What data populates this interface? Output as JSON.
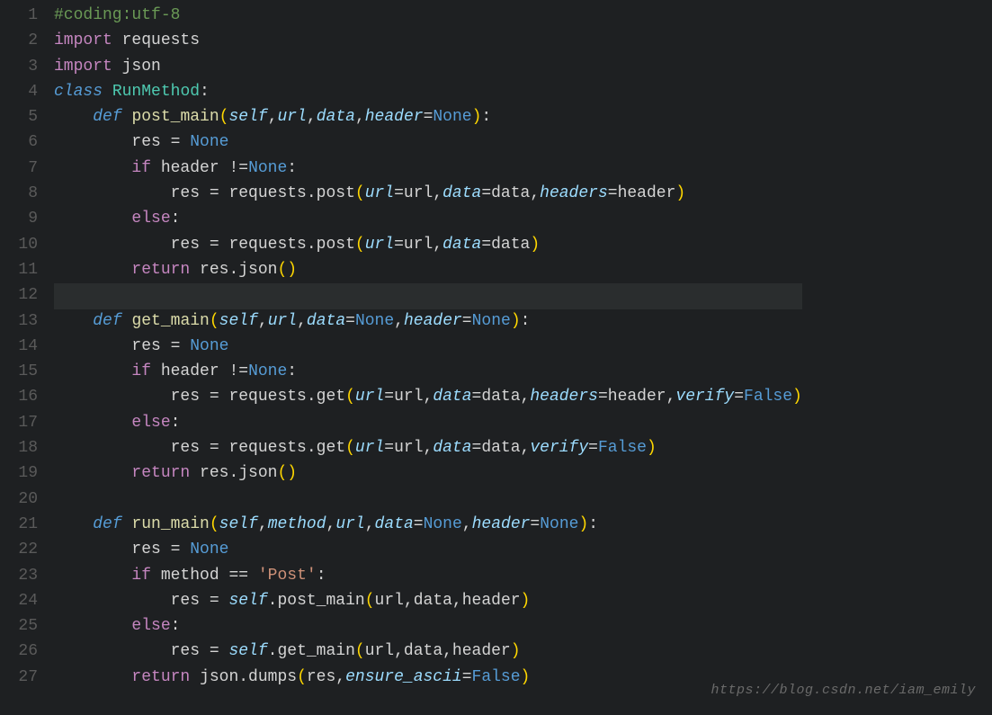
{
  "watermark": "https://blog.csdn.net/iam_emily",
  "gutter": [
    "1",
    "2",
    "3",
    "4",
    "5",
    "6",
    "7",
    "8",
    "9",
    "10",
    "11",
    "12",
    "13",
    "14",
    "15",
    "16",
    "17",
    "18",
    "19",
    "20",
    "21",
    "22",
    "23",
    "24",
    "25",
    "26",
    "27"
  ],
  "current_line_index": 11,
  "code": [
    [
      {
        "c": "cm",
        "t": "#coding:utf-8"
      }
    ],
    [
      {
        "c": "kw",
        "t": "import"
      },
      {
        "c": "va",
        "t": " requests"
      }
    ],
    [
      {
        "c": "kw",
        "t": "import"
      },
      {
        "c": "va",
        "t": " json"
      }
    ],
    [
      {
        "c": "cls",
        "t": "class"
      },
      {
        "c": "va",
        "t": " "
      },
      {
        "c": "nm",
        "t": "RunMethod"
      },
      {
        "c": "va",
        "t": ":"
      }
    ],
    [
      {
        "c": "va",
        "t": "    "
      },
      {
        "c": "cls",
        "t": "def"
      },
      {
        "c": "va",
        "t": " "
      },
      {
        "c": "fn",
        "t": "post_main"
      },
      {
        "c": "pn",
        "t": "("
      },
      {
        "c": "par",
        "t": "self"
      },
      {
        "c": "va",
        "t": ","
      },
      {
        "c": "par",
        "t": "url"
      },
      {
        "c": "va",
        "t": ","
      },
      {
        "c": "par",
        "t": "data"
      },
      {
        "c": "va",
        "t": ","
      },
      {
        "c": "par",
        "t": "header"
      },
      {
        "c": "va",
        "t": "="
      },
      {
        "c": "cn",
        "t": "None"
      },
      {
        "c": "pn",
        "t": ")"
      },
      {
        "c": "va",
        "t": ":"
      }
    ],
    [
      {
        "c": "va",
        "t": "        res "
      },
      {
        "c": "op",
        "t": "="
      },
      {
        "c": "va",
        "t": " "
      },
      {
        "c": "cn",
        "t": "None"
      }
    ],
    [
      {
        "c": "va",
        "t": "        "
      },
      {
        "c": "kw",
        "t": "if"
      },
      {
        "c": "va",
        "t": " header "
      },
      {
        "c": "op",
        "t": "!="
      },
      {
        "c": "cn",
        "t": "None"
      },
      {
        "c": "va",
        "t": ":"
      }
    ],
    [
      {
        "c": "va",
        "t": "            res "
      },
      {
        "c": "op",
        "t": "="
      },
      {
        "c": "va",
        "t": " requests.post"
      },
      {
        "c": "pn",
        "t": "("
      },
      {
        "c": "par",
        "t": "url"
      },
      {
        "c": "va",
        "t": "=url,"
      },
      {
        "c": "par",
        "t": "data"
      },
      {
        "c": "va",
        "t": "=data,"
      },
      {
        "c": "par",
        "t": "headers"
      },
      {
        "c": "va",
        "t": "=header"
      },
      {
        "c": "pn",
        "t": ")"
      }
    ],
    [
      {
        "c": "va",
        "t": "        "
      },
      {
        "c": "kw",
        "t": "else"
      },
      {
        "c": "va",
        "t": ":"
      }
    ],
    [
      {
        "c": "va",
        "t": "            res "
      },
      {
        "c": "op",
        "t": "="
      },
      {
        "c": "va",
        "t": " requests.post"
      },
      {
        "c": "pn",
        "t": "("
      },
      {
        "c": "par",
        "t": "url"
      },
      {
        "c": "va",
        "t": "=url,"
      },
      {
        "c": "par",
        "t": "data"
      },
      {
        "c": "va",
        "t": "=data"
      },
      {
        "c": "pn",
        "t": ")"
      }
    ],
    [
      {
        "c": "va",
        "t": "        "
      },
      {
        "c": "kw",
        "t": "return"
      },
      {
        "c": "va",
        "t": " res.json"
      },
      {
        "c": "pn",
        "t": "()"
      }
    ],
    [
      {
        "c": "va",
        "t": ""
      }
    ],
    [
      {
        "c": "va",
        "t": "    "
      },
      {
        "c": "cls",
        "t": "def"
      },
      {
        "c": "va",
        "t": " "
      },
      {
        "c": "fn",
        "t": "get_main"
      },
      {
        "c": "pn",
        "t": "("
      },
      {
        "c": "par",
        "t": "self"
      },
      {
        "c": "va",
        "t": ","
      },
      {
        "c": "par",
        "t": "url"
      },
      {
        "c": "va",
        "t": ","
      },
      {
        "c": "par",
        "t": "data"
      },
      {
        "c": "va",
        "t": "="
      },
      {
        "c": "cn",
        "t": "None"
      },
      {
        "c": "va",
        "t": ","
      },
      {
        "c": "par",
        "t": "header"
      },
      {
        "c": "va",
        "t": "="
      },
      {
        "c": "cn",
        "t": "None"
      },
      {
        "c": "pn",
        "t": ")"
      },
      {
        "c": "va",
        "t": ":"
      }
    ],
    [
      {
        "c": "va",
        "t": "        res "
      },
      {
        "c": "op",
        "t": "="
      },
      {
        "c": "va",
        "t": " "
      },
      {
        "c": "cn",
        "t": "None"
      }
    ],
    [
      {
        "c": "va",
        "t": "        "
      },
      {
        "c": "kw",
        "t": "if"
      },
      {
        "c": "va",
        "t": " header "
      },
      {
        "c": "op",
        "t": "!="
      },
      {
        "c": "cn",
        "t": "None"
      },
      {
        "c": "va",
        "t": ":"
      }
    ],
    [
      {
        "c": "va",
        "t": "            res "
      },
      {
        "c": "op",
        "t": "="
      },
      {
        "c": "va",
        "t": " requests.get"
      },
      {
        "c": "pn",
        "t": "("
      },
      {
        "c": "par",
        "t": "url"
      },
      {
        "c": "va",
        "t": "=url,"
      },
      {
        "c": "par",
        "t": "data"
      },
      {
        "c": "va",
        "t": "=data,"
      },
      {
        "c": "par",
        "t": "headers"
      },
      {
        "c": "va",
        "t": "=header,"
      },
      {
        "c": "par",
        "t": "verify"
      },
      {
        "c": "va",
        "t": "="
      },
      {
        "c": "cn",
        "t": "False"
      },
      {
        "c": "pn",
        "t": ")"
      }
    ],
    [
      {
        "c": "va",
        "t": "        "
      },
      {
        "c": "kw",
        "t": "else"
      },
      {
        "c": "va",
        "t": ":"
      }
    ],
    [
      {
        "c": "va",
        "t": "            res "
      },
      {
        "c": "op",
        "t": "="
      },
      {
        "c": "va",
        "t": " requests.get"
      },
      {
        "c": "pn",
        "t": "("
      },
      {
        "c": "par",
        "t": "url"
      },
      {
        "c": "va",
        "t": "=url,"
      },
      {
        "c": "par",
        "t": "data"
      },
      {
        "c": "va",
        "t": "=data,"
      },
      {
        "c": "par",
        "t": "verify"
      },
      {
        "c": "va",
        "t": "="
      },
      {
        "c": "cn",
        "t": "False"
      },
      {
        "c": "pn",
        "t": ")"
      }
    ],
    [
      {
        "c": "va",
        "t": "        "
      },
      {
        "c": "kw",
        "t": "return"
      },
      {
        "c": "va",
        "t": " res.json"
      },
      {
        "c": "pn",
        "t": "()"
      }
    ],
    [
      {
        "c": "va",
        "t": ""
      }
    ],
    [
      {
        "c": "va",
        "t": "    "
      },
      {
        "c": "cls",
        "t": "def"
      },
      {
        "c": "va",
        "t": " "
      },
      {
        "c": "fn",
        "t": "run_main"
      },
      {
        "c": "pn",
        "t": "("
      },
      {
        "c": "par",
        "t": "self"
      },
      {
        "c": "va",
        "t": ","
      },
      {
        "c": "par",
        "t": "method"
      },
      {
        "c": "va",
        "t": ","
      },
      {
        "c": "par",
        "t": "url"
      },
      {
        "c": "va",
        "t": ","
      },
      {
        "c": "par",
        "t": "data"
      },
      {
        "c": "va",
        "t": "="
      },
      {
        "c": "cn",
        "t": "None"
      },
      {
        "c": "va",
        "t": ","
      },
      {
        "c": "par",
        "t": "header"
      },
      {
        "c": "va",
        "t": "="
      },
      {
        "c": "cn",
        "t": "None"
      },
      {
        "c": "pn",
        "t": ")"
      },
      {
        "c": "va",
        "t": ":"
      }
    ],
    [
      {
        "c": "va",
        "t": "        res "
      },
      {
        "c": "op",
        "t": "="
      },
      {
        "c": "va",
        "t": " "
      },
      {
        "c": "cn",
        "t": "None"
      }
    ],
    [
      {
        "c": "va",
        "t": "        "
      },
      {
        "c": "kw",
        "t": "if"
      },
      {
        "c": "va",
        "t": " method "
      },
      {
        "c": "op",
        "t": "=="
      },
      {
        "c": "va",
        "t": " "
      },
      {
        "c": "st",
        "t": "'Post'"
      },
      {
        "c": "va",
        "t": ":"
      }
    ],
    [
      {
        "c": "va",
        "t": "            res "
      },
      {
        "c": "op",
        "t": "="
      },
      {
        "c": "va",
        "t": " "
      },
      {
        "c": "par",
        "t": "self"
      },
      {
        "c": "va",
        "t": ".post_main"
      },
      {
        "c": "pn",
        "t": "("
      },
      {
        "c": "va",
        "t": "url,data,header"
      },
      {
        "c": "pn",
        "t": ")"
      }
    ],
    [
      {
        "c": "va",
        "t": "        "
      },
      {
        "c": "kw",
        "t": "else"
      },
      {
        "c": "va",
        "t": ":"
      }
    ],
    [
      {
        "c": "va",
        "t": "            res "
      },
      {
        "c": "op",
        "t": "="
      },
      {
        "c": "va",
        "t": " "
      },
      {
        "c": "par",
        "t": "self"
      },
      {
        "c": "va",
        "t": ".get_main"
      },
      {
        "c": "pn",
        "t": "("
      },
      {
        "c": "va",
        "t": "url,data,header"
      },
      {
        "c": "pn",
        "t": ")"
      }
    ],
    [
      {
        "c": "va",
        "t": "        "
      },
      {
        "c": "kw",
        "t": "return"
      },
      {
        "c": "va",
        "t": " json.dumps"
      },
      {
        "c": "pn",
        "t": "("
      },
      {
        "c": "va",
        "t": "res,"
      },
      {
        "c": "par",
        "t": "ensure_ascii"
      },
      {
        "c": "va",
        "t": "="
      },
      {
        "c": "cn",
        "t": "False"
      },
      {
        "c": "pn",
        "t": ")"
      }
    ]
  ]
}
